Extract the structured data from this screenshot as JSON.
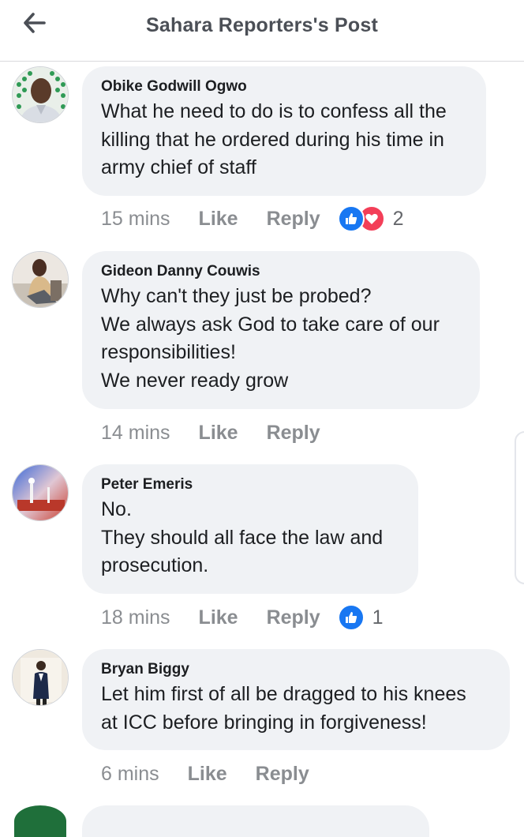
{
  "header": {
    "title": "Sahara Reporters's Post",
    "back_icon": "arrow-left-icon"
  },
  "colors": {
    "like_blue": "#1877f2",
    "love_red": "#f33e58",
    "bubble_bg": "#f0f2f5",
    "meta_gray": "#8a8d91"
  },
  "comments": [
    {
      "author": "Obike Godwill Ogwo",
      "lines": [
        "What he need to do is to confess all the",
        "killing that he ordered during his time in",
        "army chief of staff"
      ],
      "time": "15 mins",
      "like_label": "Like",
      "reply_label": "Reply",
      "reactions": [
        "like-icon",
        "love-icon"
      ],
      "reaction_count": "2"
    },
    {
      "author": "Gideon Danny Couwis",
      "lines": [
        "Why can't they just be probed?",
        "We always ask God to take care of our",
        "responsibilities!",
        "We never ready grow"
      ],
      "time": "14 mins",
      "like_label": "Like",
      "reply_label": "Reply"
    },
    {
      "author": "Peter Emeris",
      "lines": [
        "No.",
        "They should all face the law and",
        "prosecution."
      ],
      "time": "18 mins",
      "like_label": "Like",
      "reply_label": "Reply",
      "reactions": [
        "like-icon"
      ],
      "reaction_count": "1"
    },
    {
      "author": "Bryan Biggy",
      "lines": [
        "Let him first of all be dragged to his knees",
        "at ICC before bringing in forgiveness!"
      ],
      "time": "6 mins",
      "like_label": "Like",
      "reply_label": "Reply"
    }
  ]
}
